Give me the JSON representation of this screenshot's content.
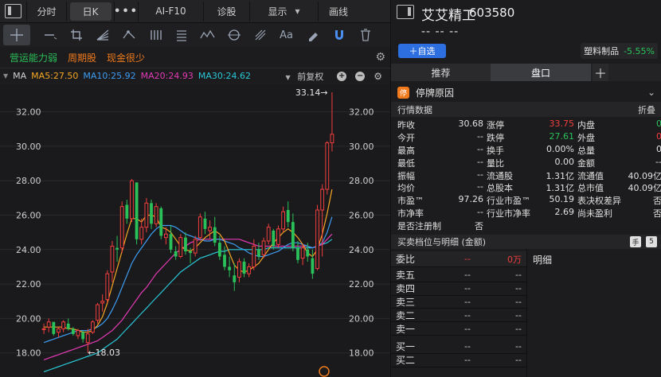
{
  "toolbar": {
    "tabs": [
      "分时",
      "日K",
      "AI-F10",
      "诊股",
      "显示",
      "画线"
    ],
    "more": "•••",
    "dropdown_caret": "▾"
  },
  "tags": [
    {
      "text": "营运能力弱",
      "color": "#2bc15a"
    },
    {
      "text": "周期股",
      "color": "#f07a1c"
    },
    {
      "text": "现金很少",
      "color": "#f07a1c"
    }
  ],
  "ma": {
    "label": "MA",
    "ma5": {
      "text": "MA5:27.50",
      "color": "#f5a623"
    },
    "ma10": {
      "text": "MA10:25.92",
      "color": "#3d9cf0"
    },
    "ma20": {
      "text": "MA20:24.93",
      "color": "#e23ab4"
    },
    "ma30": {
      "text": "MA30:24.62",
      "color": "#29c6d6"
    },
    "adjust": "前复权"
  },
  "chart_data": {
    "type": "candlestick",
    "y_ticks": [
      "32.00",
      "30.00",
      "28.00",
      "26.00",
      "24.00",
      "22.00",
      "20.00",
      "18.00"
    ],
    "ylim": [
      16.6,
      33.6
    ],
    "annotations": {
      "high": "33.14→",
      "low": "←18.03"
    },
    "up_color": "#f23e3e",
    "down_color": "#2bc15a",
    "candles": [
      [
        19.4,
        19.7,
        19.1,
        19.4
      ],
      [
        19.5,
        20.0,
        19.2,
        19.8
      ],
      [
        19.8,
        19.8,
        19.0,
        19.1
      ],
      [
        19.2,
        19.5,
        18.9,
        19.4
      ],
      [
        19.4,
        19.9,
        19.2,
        19.8
      ],
      [
        19.7,
        20.0,
        19.3,
        19.4
      ],
      [
        19.4,
        19.5,
        19.0,
        19.1
      ],
      [
        19.0,
        19.4,
        18.8,
        19.3
      ],
      [
        19.2,
        19.3,
        18.6,
        18.8
      ],
      [
        18.6,
        19.4,
        18.0,
        19.1
      ],
      [
        19.2,
        19.9,
        19.1,
        19.8
      ],
      [
        19.9,
        20.9,
        19.7,
        20.8
      ],
      [
        20.9,
        21.4,
        20.4,
        21.0
      ],
      [
        21.1,
        22.8,
        20.9,
        22.6
      ],
      [
        22.7,
        24.5,
        22.1,
        24.2
      ],
      [
        24.1,
        24.8,
        23.3,
        24.0
      ],
      [
        24.1,
        26.8,
        23.8,
        26.5
      ],
      [
        26.6,
        26.9,
        25.5,
        25.8
      ],
      [
        25.8,
        28.1,
        25.6,
        28.0
      ],
      [
        27.9,
        27.9,
        24.3,
        24.6
      ],
      [
        24.6,
        25.8,
        24.3,
        25.3
      ],
      [
        25.3,
        27.0,
        25.0,
        26.7
      ],
      [
        26.7,
        26.9,
        25.2,
        25.5
      ],
      [
        25.5,
        26.7,
        25.3,
        26.5
      ],
      [
        26.4,
        26.5,
        24.6,
        24.8
      ],
      [
        24.7,
        25.3,
        24.3,
        24.9
      ],
      [
        24.9,
        25.4,
        23.8,
        24.0
      ],
      [
        23.9,
        24.2,
        23.4,
        23.6
      ],
      [
        23.6,
        24.9,
        23.5,
        24.7
      ],
      [
        24.7,
        25.0,
        23.7,
        23.9
      ],
      [
        23.9,
        24.1,
        23.2,
        23.8
      ],
      [
        23.8,
        24.8,
        23.6,
        24.6
      ],
      [
        24.7,
        26.1,
        24.5,
        25.9
      ],
      [
        25.8,
        26.2,
        24.9,
        25.2
      ],
      [
        25.1,
        25.7,
        24.6,
        25.3
      ],
      [
        25.3,
        25.9,
        24.2,
        24.4
      ],
      [
        24.4,
        24.8,
        23.4,
        23.6
      ],
      [
        23.7,
        24.2,
        22.8,
        23.0
      ],
      [
        23.0,
        23.6,
        22.4,
        22.8
      ],
      [
        22.5,
        23.2,
        21.6,
        22.1
      ],
      [
        22.4,
        23.5,
        22.1,
        23.3
      ],
      [
        23.3,
        23.5,
        22.4,
        22.6
      ],
      [
        22.6,
        23.2,
        22.4,
        23.0
      ],
      [
        23.0,
        24.6,
        22.8,
        24.2
      ],
      [
        24.0,
        24.4,
        23.4,
        23.6
      ],
      [
        23.7,
        24.7,
        23.5,
        24.5
      ],
      [
        24.5,
        25.5,
        24.3,
        25.3
      ],
      [
        25.1,
        25.2,
        24.0,
        24.2
      ],
      [
        24.3,
        25.4,
        24.1,
        25.2
      ],
      [
        25.2,
        26.5,
        25.0,
        26.2
      ],
      [
        26.3,
        26.8,
        25.3,
        25.6
      ],
      [
        25.6,
        26.1,
        23.9,
        24.1
      ],
      [
        24.1,
        24.5,
        23.2,
        23.4
      ],
      [
        23.5,
        24.3,
        23.1,
        24.1
      ],
      [
        24.0,
        24.4,
        23.3,
        23.6
      ],
      [
        23.5,
        24.0,
        22.3,
        22.6
      ],
      [
        22.9,
        26.6,
        22.8,
        26.3
      ],
      [
        26.3,
        27.8,
        23.6,
        27.5
      ],
      [
        27.5,
        30.3,
        27.2,
        30.2
      ],
      [
        30.2,
        33.14,
        29.7,
        30.7
      ]
    ],
    "ma5": [
      19.5,
      19.5,
      19.5,
      19.5,
      19.5,
      19.4,
      19.4,
      19.3,
      19.2,
      19.2,
      19.3,
      19.6,
      20.1,
      20.9,
      21.9,
      22.9,
      23.9,
      24.9,
      25.8,
      25.8,
      25.6,
      26.0,
      26.0,
      25.9,
      25.3,
      25.2,
      25.0,
      24.6,
      24.2,
      24.0,
      23.9,
      24.1,
      24.4,
      24.7,
      24.9,
      25.1,
      24.9,
      24.5,
      23.8,
      23.1,
      22.8,
      22.7,
      22.8,
      23.0,
      23.2,
      23.6,
      24.0,
      24.4,
      24.7,
      25.0,
      25.2,
      25.0,
      24.7,
      24.3,
      23.8,
      23.6,
      24.0,
      24.9,
      26.1,
      27.5
    ],
    "ma10": [
      18.6,
      18.7,
      18.8,
      18.9,
      19.0,
      19.1,
      19.2,
      19.3,
      19.3,
      19.3,
      19.4,
      19.5,
      19.7,
      20.0,
      20.5,
      21.1,
      21.8,
      22.5,
      23.2,
      23.7,
      24.1,
      24.5,
      24.9,
      25.2,
      25.4,
      25.4,
      25.4,
      25.3,
      25.1,
      24.9,
      24.8,
      24.7,
      24.6,
      24.5,
      24.5,
      24.6,
      24.6,
      24.5,
      24.4,
      24.3,
      24.1,
      24.0,
      23.8,
      23.7,
      23.6,
      23.6,
      23.7,
      23.8,
      23.9,
      24.1,
      24.3,
      24.4,
      24.4,
      24.3,
      24.2,
      24.1,
      24.2,
      24.4,
      25.0,
      25.9
    ],
    "ma20": [
      17.6,
      17.7,
      17.8,
      17.9,
      18.0,
      18.1,
      18.2,
      18.3,
      18.4,
      18.5,
      18.6,
      18.7,
      18.9,
      19.1,
      19.3,
      19.6,
      19.9,
      20.3,
      20.7,
      21.1,
      21.5,
      21.8,
      22.2,
      22.6,
      22.9,
      23.2,
      23.5,
      23.8,
      24.0,
      24.2,
      24.4,
      24.5,
      24.6,
      24.6,
      24.6,
      24.6,
      24.6,
      24.6,
      24.6,
      24.6,
      24.6,
      24.5,
      24.4,
      24.3,
      24.2,
      24.2,
      24.2,
      24.2,
      24.2,
      24.2,
      24.2,
      24.2,
      24.2,
      24.2,
      24.2,
      24.1,
      24.2,
      24.3,
      24.6,
      24.9
    ],
    "ma30": [
      16.9,
      17.0,
      17.1,
      17.2,
      17.3,
      17.4,
      17.5,
      17.6,
      17.7,
      17.8,
      17.9,
      18.0,
      18.2,
      18.4,
      18.6,
      18.8,
      19.1,
      19.4,
      19.7,
      20.0,
      20.3,
      20.6,
      20.9,
      21.2,
      21.5,
      21.8,
      22.1,
      22.4,
      22.7,
      22.9,
      23.1,
      23.3,
      23.5,
      23.6,
      23.7,
      23.8,
      23.9,
      23.9,
      24.0,
      24.0,
      24.0,
      24.0,
      24.0,
      24.0,
      24.0,
      24.0,
      24.1,
      24.1,
      24.1,
      24.1,
      24.1,
      24.1,
      24.1,
      24.1,
      24.1,
      24.1,
      24.2,
      24.3,
      24.4,
      24.6
    ]
  },
  "stock": {
    "name": "艾艾精工",
    "code": "603580",
    "price": "-- -- --",
    "add_label": "＋自选",
    "sector": "塑料制品",
    "sector_change": "-5.55%"
  },
  "panel_tabs": {
    "recommend": "推荐",
    "board": "盘口",
    "plus": "＋"
  },
  "halt": {
    "icon": "停",
    "text": "停牌原因",
    "chevron": "⌄"
  },
  "quote": {
    "title": "行情数据",
    "fold": "折叠",
    "rows": [
      [
        [
          "昨收",
          "30.68",
          "wh"
        ],
        [
          "涨停",
          "33.75",
          "red"
        ],
        [
          "内盘",
          "0",
          "green"
        ]
      ],
      [
        [
          "今开",
          "--",
          "wh"
        ],
        [
          "跌停",
          "27.61",
          "green"
        ],
        [
          "外盘",
          "0",
          "red"
        ]
      ],
      [
        [
          "最高",
          "--",
          "wh"
        ],
        [
          "换手",
          "0.00%",
          "wh"
        ],
        [
          "总量",
          "0",
          "wh"
        ]
      ],
      [
        [
          "最低",
          "--",
          "wh"
        ],
        [
          "量比",
          "0.00",
          "wh"
        ],
        [
          "金额",
          "--",
          "wh"
        ]
      ],
      [
        [
          "振幅",
          "--",
          "wh"
        ],
        [
          "流通股",
          "1.31亿",
          "wh"
        ],
        [
          "流通值",
          "40.09亿",
          "wh"
        ]
      ],
      [
        [
          "均价",
          "--",
          "wh"
        ],
        [
          "总股本",
          "1.31亿",
          "wh"
        ],
        [
          "总市值",
          "40.09亿",
          "wh"
        ]
      ],
      [
        [
          "市盈™",
          "97.26",
          "wh"
        ],
        [
          "行业市盈™",
          "50.19",
          "wh"
        ],
        [
          "表决权差异",
          "否",
          "wh"
        ]
      ],
      [
        [
          "市净率",
          "--",
          "wh"
        ],
        [
          "行业市净率",
          "2.69",
          "wh"
        ],
        [
          "尚未盈利",
          "否",
          "wh"
        ]
      ],
      [
        [
          "是否注册制",
          "否",
          "wh"
        ],
        [
          "",
          "",
          "wh"
        ],
        [
          "",
          "",
          "wh"
        ]
      ]
    ]
  },
  "orderbook": {
    "title": "买卖档位与明细 (金额)",
    "icons": [
      "手",
      "5"
    ],
    "weibi_label": "委比",
    "weibi_value": "--",
    "weibi_amount": "0万",
    "detail_label": "明细",
    "asks": [
      [
        "卖五",
        "--",
        "--"
      ],
      [
        "卖四",
        "--",
        "--"
      ],
      [
        "卖三",
        "--",
        "--"
      ],
      [
        "卖二",
        "--",
        "--"
      ],
      [
        "卖一",
        "--",
        "--"
      ]
    ],
    "bids": [
      [
        "买一",
        "--",
        "--"
      ],
      [
        "买二",
        "--",
        "--"
      ]
    ]
  }
}
